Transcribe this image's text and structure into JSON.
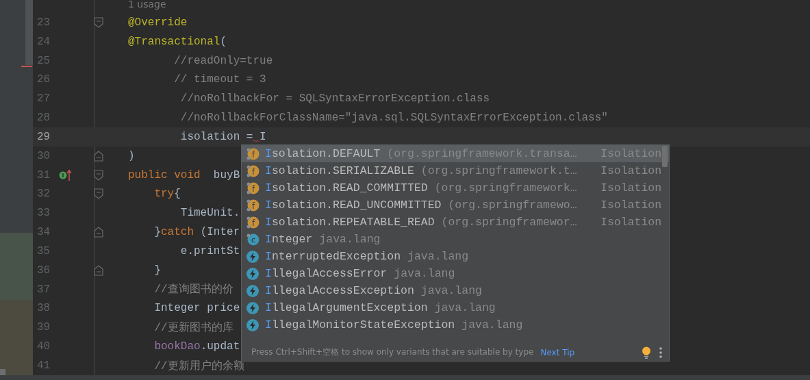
{
  "editor": {
    "usage_hint": "1 usage",
    "lines": [
      {
        "number": "23",
        "current": false,
        "fold_start": true,
        "fold_end": false,
        "implemented": false,
        "tokens": [
          {
            "kind": "annotation",
            "text": "@Override"
          }
        ]
      },
      {
        "number": "24",
        "current": false,
        "fold_start": false,
        "fold_end": false,
        "implemented": false,
        "tokens": [
          {
            "kind": "annotation",
            "text": "@Transactional"
          },
          {
            "kind": "plain",
            "text": "("
          }
        ]
      },
      {
        "number": "25",
        "current": false,
        "fold_start": false,
        "fold_end": false,
        "implemented": false,
        "tokens": [
          {
            "kind": "comment",
            "text": "       //readOnly=true"
          }
        ]
      },
      {
        "number": "26",
        "current": false,
        "fold_start": false,
        "fold_end": false,
        "implemented": false,
        "tokens": [
          {
            "kind": "comment",
            "text": "       // timeout = 3"
          }
        ]
      },
      {
        "number": "27",
        "current": false,
        "fold_start": false,
        "fold_end": false,
        "implemented": false,
        "tokens": [
          {
            "kind": "comment",
            "text": "        //noRollbackFor = SQLSyntaxErrorException.class"
          }
        ]
      },
      {
        "number": "28",
        "current": false,
        "fold_start": false,
        "fold_end": false,
        "implemented": false,
        "tokens": [
          {
            "kind": "comment",
            "text": "        //noRollbackForClassName=\"java.sql.SQLSyntaxErrorException.class\""
          }
        ]
      },
      {
        "number": "29",
        "current": true,
        "fold_start": false,
        "fold_end": false,
        "implemented": false,
        "tokens": [
          {
            "kind": "plain",
            "text": "        isolation ="
          },
          {
            "kind": "plain",
            "text": "I",
            "squiggle": true
          }
        ]
      },
      {
        "number": "30",
        "current": false,
        "fold_start": false,
        "fold_end": true,
        "implemented": false,
        "tokens": [
          {
            "kind": "plain",
            "text": ")"
          }
        ]
      },
      {
        "number": "31",
        "current": false,
        "fold_start": true,
        "fold_end": false,
        "implemented": true,
        "tokens": [
          {
            "kind": "keyword",
            "text": "public void"
          },
          {
            "kind": "plain",
            "text": "  buyB"
          }
        ]
      },
      {
        "number": "32",
        "current": false,
        "fold_start": true,
        "fold_end": false,
        "implemented": false,
        "tokens": [
          {
            "kind": "keyword",
            "text": "    try"
          },
          {
            "kind": "plain",
            "text": "{"
          }
        ]
      },
      {
        "number": "33",
        "current": false,
        "fold_start": false,
        "fold_end": false,
        "implemented": false,
        "tokens": [
          {
            "kind": "plain",
            "text": "        TimeUnit."
          }
        ]
      },
      {
        "number": "34",
        "current": false,
        "fold_start": false,
        "fold_end": true,
        "implemented": false,
        "tokens": [
          {
            "kind": "plain",
            "text": "    }"
          },
          {
            "kind": "keyword",
            "text": "catch"
          },
          {
            "kind": "plain",
            "text": " (Inter"
          }
        ]
      },
      {
        "number": "35",
        "current": false,
        "fold_start": false,
        "fold_end": false,
        "implemented": false,
        "tokens": [
          {
            "kind": "plain",
            "text": "        e.printSt"
          }
        ]
      },
      {
        "number": "36",
        "current": false,
        "fold_start": false,
        "fold_end": true,
        "implemented": false,
        "tokens": [
          {
            "kind": "plain",
            "text": "    }"
          }
        ]
      },
      {
        "number": "37",
        "current": false,
        "fold_start": false,
        "fold_end": false,
        "implemented": false,
        "tokens": [
          {
            "kind": "comment",
            "text": "    //查询图书的价"
          }
        ]
      },
      {
        "number": "38",
        "current": false,
        "fold_start": false,
        "fold_end": false,
        "implemented": false,
        "tokens": [
          {
            "kind": "plain",
            "text": "    Integer price"
          }
        ]
      },
      {
        "number": "39",
        "current": false,
        "fold_start": false,
        "fold_end": false,
        "implemented": false,
        "tokens": [
          {
            "kind": "comment",
            "text": "    //更新图书的库"
          }
        ]
      },
      {
        "number": "40",
        "current": false,
        "fold_start": false,
        "fold_end": false,
        "implemented": false,
        "tokens": [
          {
            "kind": "field",
            "text": "    bookDao"
          },
          {
            "kind": "plain",
            "text": ".updat"
          }
        ]
      },
      {
        "number": "41",
        "current": false,
        "fold_start": false,
        "fold_end": false,
        "implemented": false,
        "tokens": [
          {
            "kind": "comment",
            "text": "    //更新用户的余额"
          }
        ]
      }
    ]
  },
  "completion": {
    "items": [
      {
        "kind": "field",
        "badge": "f",
        "matched": "I",
        "name": "solation.DEFAULT",
        "detail": "(org.springframework.transa…",
        "type": "Isolation",
        "selected": true
      },
      {
        "kind": "field",
        "badge": "f",
        "matched": "I",
        "name": "solation.SERIALIZABLE",
        "detail": "(org.springframework.t…",
        "type": "Isolation",
        "selected": false
      },
      {
        "kind": "field",
        "badge": "f",
        "matched": "I",
        "name": "solation.READ_COMMITTED",
        "detail": "(org.springframework…",
        "type": "Isolation",
        "selected": false
      },
      {
        "kind": "field",
        "badge": "f",
        "matched": "I",
        "name": "solation.READ_UNCOMMITTED",
        "detail": "(org.springframewo…",
        "type": "Isolation",
        "selected": false
      },
      {
        "kind": "field",
        "badge": "f",
        "matched": "I",
        "name": "solation.REPEATABLE_READ",
        "detail": "(org.springframewor…",
        "type": "Isolation",
        "selected": false
      },
      {
        "kind": "class",
        "badge": "c",
        "matched": "I",
        "name": "nteger",
        "detail": "java.lang",
        "selected": false
      },
      {
        "kind": "exception",
        "matched": "I",
        "name": "nterruptedException",
        "detail": "java.lang",
        "selected": false
      },
      {
        "kind": "exception",
        "matched": "I",
        "name": "llegalAccessError",
        "detail": "java.lang",
        "selected": false
      },
      {
        "kind": "exception",
        "matched": "I",
        "name": "llegalAccessException",
        "detail": "java.lang",
        "selected": false
      },
      {
        "kind": "exception",
        "matched": "I",
        "name": "llegalArgumentException",
        "detail": "java.lang",
        "selected": false
      },
      {
        "kind": "exception",
        "matched": "I",
        "name": "llegalMonitorStateException",
        "detail": "java.lang",
        "selected": false
      }
    ],
    "footer": {
      "hint": "Press Ctrl+Shift+空格 to show only variants that are suitable by type",
      "link": "Next Tip"
    }
  }
}
